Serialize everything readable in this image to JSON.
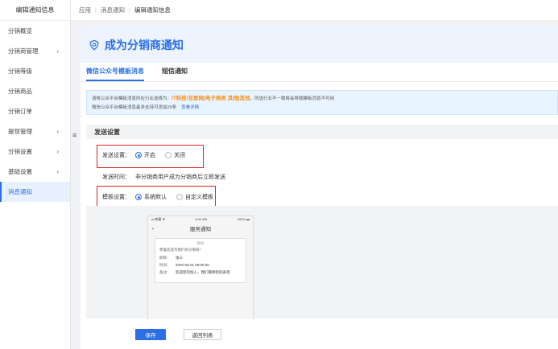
{
  "sidebar": {
    "header": "编辑通知信息",
    "items": [
      {
        "label": "分销概览",
        "chevron": ""
      },
      {
        "label": "分销商管理",
        "chevron": "›"
      },
      {
        "label": "分销等级",
        "chevron": ""
      },
      {
        "label": "分销商品",
        "chevron": ""
      },
      {
        "label": "分销订单",
        "chevron": ""
      },
      {
        "label": "提现管理",
        "chevron": "›"
      },
      {
        "label": "分销设置",
        "chevron": "›"
      },
      {
        "label": "基础设置",
        "chevron": "›"
      },
      {
        "label": "消息通知",
        "chevron": ""
      }
    ]
  },
  "collapse_icon": "≡",
  "breadcrumb": {
    "a": "应用",
    "b": "消息通知",
    "c": "编辑通知信息"
  },
  "page": {
    "title": "成为分销商通知"
  },
  "tabs": [
    {
      "label": "微信公众号模板消息"
    },
    {
      "label": "短信通知"
    }
  ],
  "notice": {
    "line1_pre": "请将公众平台模板消息所在行业选择为：",
    "line1_hl": "IT科技/互联网|电子商务 其他|其他",
    "line1_post": "，所选行业不一致将会导致模板消息不可用",
    "line2": "微信公众平台模板消息最多支持可添加25条",
    "link": "查看详情"
  },
  "section": {
    "title": "发送设置"
  },
  "send": {
    "label": "发送设置：",
    "on": "开启",
    "off": "关闭"
  },
  "send_time": {
    "label": "发送时间：",
    "value": "非分销商用户成为分销商后立即发送"
  },
  "template": {
    "label": "模板设置：",
    "default": "系统默认",
    "custom": "自定义模板"
  },
  "phone": {
    "carrier": "ııl 商量 ☰",
    "time": "9:41 AM",
    "battery": "100% ▬",
    "back": "‹",
    "nav_title": "服务通知",
    "card_title": "模板",
    "desc": "恭喜您成为我们的分销商！",
    "rows": [
      {
        "k": "昵称：",
        "v": "张三"
      },
      {
        "k": "时间：",
        "v": "2020-06-01 09:00:00"
      },
      {
        "k": "备注：",
        "v": "欢迎您的加入，我们期待您的表现"
      }
    ]
  },
  "buttons": {
    "save": "保存",
    "back": "返回列表"
  },
  "colors": {
    "accent": "#2a6fe6",
    "highlight": "#fa8c16",
    "annotation": "#e02020"
  }
}
